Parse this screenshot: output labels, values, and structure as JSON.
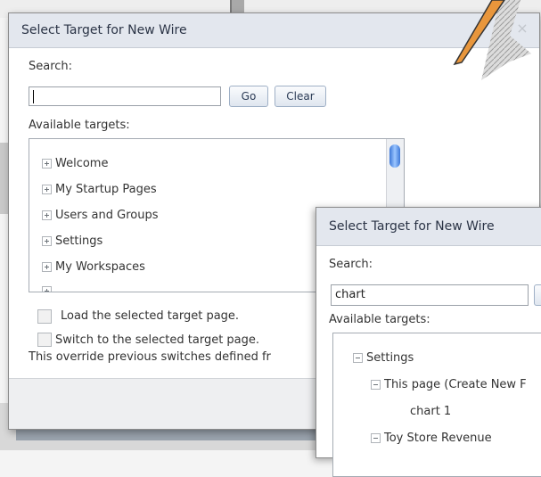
{
  "dialog1": {
    "title": "Select Target for New Wire",
    "search_label": "Search:",
    "search_value": "",
    "go_label": "Go",
    "clear_label": "Clear",
    "available_label": "Available targets:",
    "tree_items": [
      "Welcome",
      "My Startup Pages",
      "Users and Groups",
      "Settings",
      "My Workspaces"
    ],
    "load_label": "Load the selected target page.",
    "switch_label": "Switch to the selected target page.",
    "override_text": "This override previous switches defined fr"
  },
  "dialog2": {
    "title": "Select Target for New Wire",
    "search_label": "Search:",
    "search_value": "chart",
    "available_label": "Available targets:",
    "tree": {
      "settings": "Settings",
      "this_page": "This page (Create New F",
      "chart1": "chart 1",
      "toy_store": "Toy Store Revenue"
    }
  },
  "colors": {
    "header_bg": "#e3e7ee",
    "button_border": "#9fb0c6",
    "scroll_thumb": "#3d78d8",
    "cursor_orange": "#e8963c"
  }
}
